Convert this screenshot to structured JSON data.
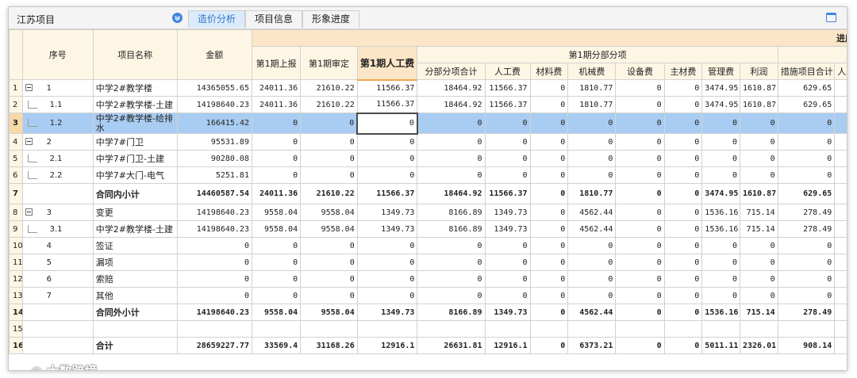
{
  "project_title": "江苏项目",
  "tabs": [
    "造价分析",
    "项目信息",
    "形象进度"
  ],
  "watermark": "大数跨境",
  "headers": {
    "jindu": "进度计",
    "xuhao": "序号",
    "name": "项目名称",
    "amount": "金额",
    "p1_report": "第1期上报",
    "p1_audit": "第1期审定",
    "p1_labor": "第1期人工费",
    "p1_sub": "第1期分部分项",
    "subtotal": "分部分项合计",
    "labor": "人工费",
    "material": "材料费",
    "machine": "机械费",
    "equipment": "设备费",
    "main_mat": "主材费",
    "manage": "管理费",
    "profit": "利润",
    "measure": "措施项目合计",
    "labor2": "人工费"
  },
  "rows": [
    {
      "rn": "1",
      "seq": "1",
      "name": "中学2#教学楼",
      "amount": "14365055.65",
      "report": "24011.36",
      "audit": "21610.22",
      "labor_p": "11566.37",
      "sub": "18464.92",
      "labor": "11566.37",
      "mat": "0",
      "mach": "1810.77",
      "equip": "0",
      "main": "0",
      "mgmt": "3474.95",
      "profit": "1610.87",
      "meas": "629.65",
      "labor2": ""
    },
    {
      "rn": "2",
      "seq": "1.1",
      "name": "中学2#教学楼-土建",
      "amount": "14198640.23",
      "report": "24011.36",
      "audit": "21610.22",
      "labor_p": "11566.37",
      "sub": "18464.92",
      "labor": "11566.37",
      "mat": "0",
      "mach": "1810.77",
      "equip": "0",
      "main": "0",
      "mgmt": "3474.95",
      "profit": "1610.87",
      "meas": "629.65",
      "labor2": ""
    },
    {
      "rn": "3",
      "seq": "1.2",
      "name": "中学2#教学楼-给排水",
      "amount": "166415.42",
      "report": "0",
      "audit": "0",
      "labor_p": "0",
      "sub": "0",
      "labor": "0",
      "mat": "0",
      "mach": "0",
      "equip": "0",
      "main": "0",
      "mgmt": "0",
      "profit": "0",
      "meas": "0",
      "labor2": ""
    },
    {
      "rn": "4",
      "seq": "2",
      "name": "中学7#门卫",
      "amount": "95531.89",
      "report": "0",
      "audit": "0",
      "labor_p": "0",
      "sub": "0",
      "labor": "0",
      "mat": "0",
      "mach": "0",
      "equip": "0",
      "main": "0",
      "mgmt": "0",
      "profit": "0",
      "meas": "0",
      "labor2": ""
    },
    {
      "rn": "5",
      "seq": "2.1",
      "name": "中学7#门卫-土建",
      "amount": "90280.08",
      "report": "0",
      "audit": "0",
      "labor_p": "0",
      "sub": "0",
      "labor": "0",
      "mat": "0",
      "mach": "0",
      "equip": "0",
      "main": "0",
      "mgmt": "0",
      "profit": "0",
      "meas": "0",
      "labor2": ""
    },
    {
      "rn": "6",
      "seq": "2.2",
      "name": "中学7#大门-电气",
      "amount": "5251.81",
      "report": "0",
      "audit": "0",
      "labor_p": "0",
      "sub": "0",
      "labor": "0",
      "mat": "0",
      "mach": "0",
      "equip": "0",
      "main": "0",
      "mgmt": "0",
      "profit": "0",
      "meas": "0",
      "labor2": ""
    },
    {
      "rn": "7",
      "seq": "",
      "name": "合同内小计",
      "amount": "14460587.54",
      "report": "24011.36",
      "audit": "21610.22",
      "labor_p": "11566.37",
      "sub": "18464.92",
      "labor": "11566.37",
      "mat": "0",
      "mach": "1810.77",
      "equip": "0",
      "main": "0",
      "mgmt": "3474.95",
      "profit": "1610.87",
      "meas": "629.65",
      "labor2": ""
    },
    {
      "rn": "8",
      "seq": "3",
      "name": "变更",
      "amount": "14198640.23",
      "report": "9558.04",
      "audit": "9558.04",
      "labor_p": "1349.73",
      "sub": "8166.89",
      "labor": "1349.73",
      "mat": "0",
      "mach": "4562.44",
      "equip": "0",
      "main": "0",
      "mgmt": "1536.16",
      "profit": "715.14",
      "meas": "278.49",
      "labor2": ""
    },
    {
      "rn": "9",
      "seq": "3.1",
      "name": "中学2#教学楼-土建",
      "amount": "14198640.23",
      "report": "9558.04",
      "audit": "9558.04",
      "labor_p": "1349.73",
      "sub": "8166.89",
      "labor": "1349.73",
      "mat": "0",
      "mach": "4562.44",
      "equip": "0",
      "main": "0",
      "mgmt": "1536.16",
      "profit": "715.14",
      "meas": "278.49",
      "labor2": ""
    },
    {
      "rn": "10",
      "seq": "4",
      "name": "签证",
      "amount": "0",
      "report": "0",
      "audit": "0",
      "labor_p": "0",
      "sub": "0",
      "labor": "0",
      "mat": "0",
      "mach": "0",
      "equip": "0",
      "main": "0",
      "mgmt": "0",
      "profit": "0",
      "meas": "0",
      "labor2": ""
    },
    {
      "rn": "11",
      "seq": "5",
      "name": "漏项",
      "amount": "0",
      "report": "0",
      "audit": "0",
      "labor_p": "0",
      "sub": "0",
      "labor": "0",
      "mat": "0",
      "mach": "0",
      "equip": "0",
      "main": "0",
      "mgmt": "0",
      "profit": "0",
      "meas": "0",
      "labor2": ""
    },
    {
      "rn": "12",
      "seq": "6",
      "name": "索赔",
      "amount": "0",
      "report": "0",
      "audit": "0",
      "labor_p": "0",
      "sub": "0",
      "labor": "0",
      "mat": "0",
      "mach": "0",
      "equip": "0",
      "main": "0",
      "mgmt": "0",
      "profit": "0",
      "meas": "0",
      "labor2": ""
    },
    {
      "rn": "13",
      "seq": "7",
      "name": "其他",
      "amount": "0",
      "report": "0",
      "audit": "0",
      "labor_p": "0",
      "sub": "0",
      "labor": "0",
      "mat": "0",
      "mach": "0",
      "equip": "0",
      "main": "0",
      "mgmt": "0",
      "profit": "0",
      "meas": "0",
      "labor2": ""
    },
    {
      "rn": "14",
      "seq": "",
      "name": "合同外小计",
      "amount": "14198640.23",
      "report": "9558.04",
      "audit": "9558.04",
      "labor_p": "1349.73",
      "sub": "8166.89",
      "labor": "1349.73",
      "mat": "0",
      "mach": "4562.44",
      "equip": "0",
      "main": "0",
      "mgmt": "1536.16",
      "profit": "715.14",
      "meas": "278.49",
      "labor2": ""
    },
    {
      "rn": "15",
      "seq": "",
      "name": "",
      "amount": "",
      "report": "",
      "audit": "",
      "labor_p": "",
      "sub": "",
      "labor": "",
      "mat": "",
      "mach": "",
      "equip": "",
      "main": "",
      "mgmt": "",
      "profit": "",
      "meas": "",
      "labor2": ""
    },
    {
      "rn": "16",
      "seq": "",
      "name": "合计",
      "amount": "28659227.77",
      "report": "33569.4",
      "audit": "31168.26",
      "labor_p": "12916.1",
      "sub": "26631.81",
      "labor": "12916.1",
      "mat": "0",
      "mach": "6373.21",
      "equip": "0",
      "main": "0",
      "mgmt": "5011.11",
      "profit": "2326.01",
      "meas": "908.14",
      "labor2": ""
    }
  ],
  "row_kinds": {
    "bold_rows": [
      "7",
      "14",
      "16"
    ],
    "selected_row": "3",
    "collapsible_rows": [
      "1",
      "4",
      "8"
    ],
    "child_rows": [
      "2",
      "3",
      "5",
      "6",
      "9"
    ],
    "tall_rows": [
      "3",
      "7"
    ]
  },
  "colors": {
    "accent": "#2e77c9",
    "selected_row": "#a9cdf2",
    "header_bg": "#fdf6e4",
    "highlight_header": "#fbe6c7"
  }
}
